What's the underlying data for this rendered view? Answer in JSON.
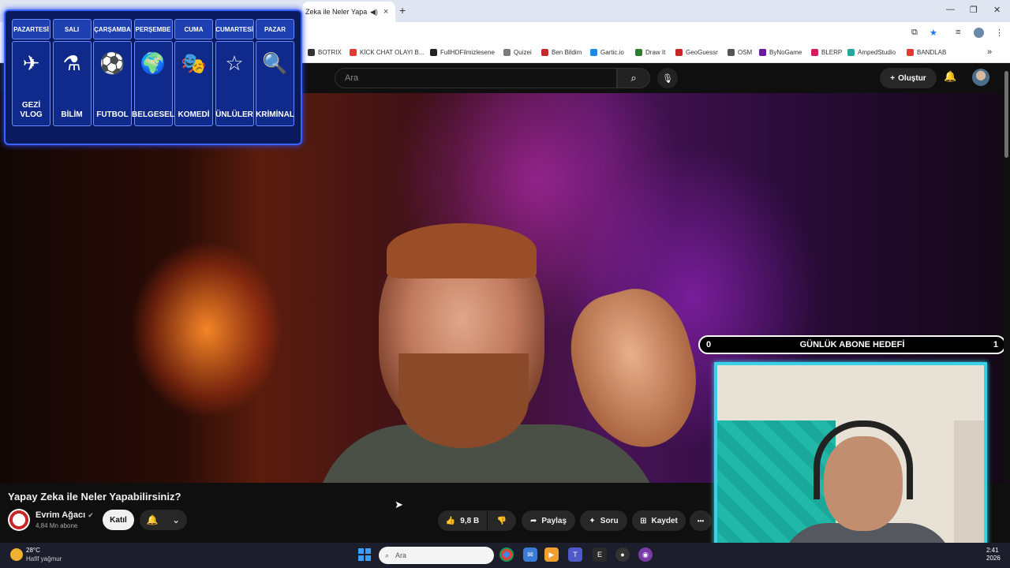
{
  "browser": {
    "tab_title": "Zeka ile Neler Yapab",
    "new_tab": "+",
    "bookmarks": [
      {
        "label": "BOTRIX",
        "color": "#333"
      },
      {
        "label": "KİCK CHAT OLAYI B...",
        "color": "#e53935"
      },
      {
        "label": "FullHDFilmizlesene",
        "color": "#222"
      },
      {
        "label": "Quizei",
        "color": "#7b7b7b"
      },
      {
        "label": "Ben Bildim",
        "color": "#c62828"
      },
      {
        "label": "Gartic.io",
        "color": "#1e88e5"
      },
      {
        "label": "Draw It",
        "color": "#2e7d32"
      },
      {
        "label": "GeoGuessr",
        "color": "#c62828"
      },
      {
        "label": "OSM",
        "color": "#555"
      },
      {
        "label": "ByNoGame",
        "color": "#6a1b9a"
      },
      {
        "label": "BLERP",
        "color": "#d81b60"
      },
      {
        "label": "AmpedStudio",
        "color": "#26a69a"
      },
      {
        "label": "BANDLAB",
        "color": "#e53935"
      }
    ],
    "bookmarks_more": "»"
  },
  "youtube": {
    "search_placeholder": "Ara",
    "create_label": "Oluştur",
    "video_title": "Yapay Zeka ile Neler Yapabilirsiniz?",
    "channel_name": "Evrim Ağacı",
    "channel_subs": "4,84 Mn abone",
    "join_label": "Katıl",
    "like_count": "9,8 B",
    "share_label": "Paylaş",
    "ask_label": "Soru",
    "save_label": "Kaydet",
    "more_label": "•••"
  },
  "schedule": [
    {
      "day": "PAZARTESİ",
      "icon": "✈",
      "icon_name": "globe-plane-icon",
      "label": "GEZİ VLOG"
    },
    {
      "day": "SALI",
      "icon": "⚗",
      "icon_name": "science-icon",
      "label": "BİLİM"
    },
    {
      "day": "ÇARŞAMBA",
      "icon": "⚽",
      "icon_name": "football-icon",
      "label": "FUTBOL"
    },
    {
      "day": "PERŞEMBE",
      "icon": "🌍",
      "icon_name": "globe-icon",
      "label": "BELGESEL"
    },
    {
      "day": "CUMA",
      "icon": "🎭",
      "icon_name": "theater-masks-icon",
      "label": "KOMEDİ"
    },
    {
      "day": "CUMARTESİ",
      "icon": "☆",
      "icon_name": "star-icon",
      "label": "ÜNLÜLER"
    },
    {
      "day": "PAZAR",
      "icon": "🔍",
      "icon_name": "magnifier-icon",
      "label": "KRİMİNAL"
    }
  ],
  "goal": {
    "left": "0",
    "title": "GÜNLÜK ABONE HEDEFİ",
    "right": "1"
  },
  "taskbar": {
    "temperature": "28°C",
    "weather": "Hafif yağmur",
    "search_placeholder": "Ara",
    "time": "2:41",
    "date": "2026"
  }
}
